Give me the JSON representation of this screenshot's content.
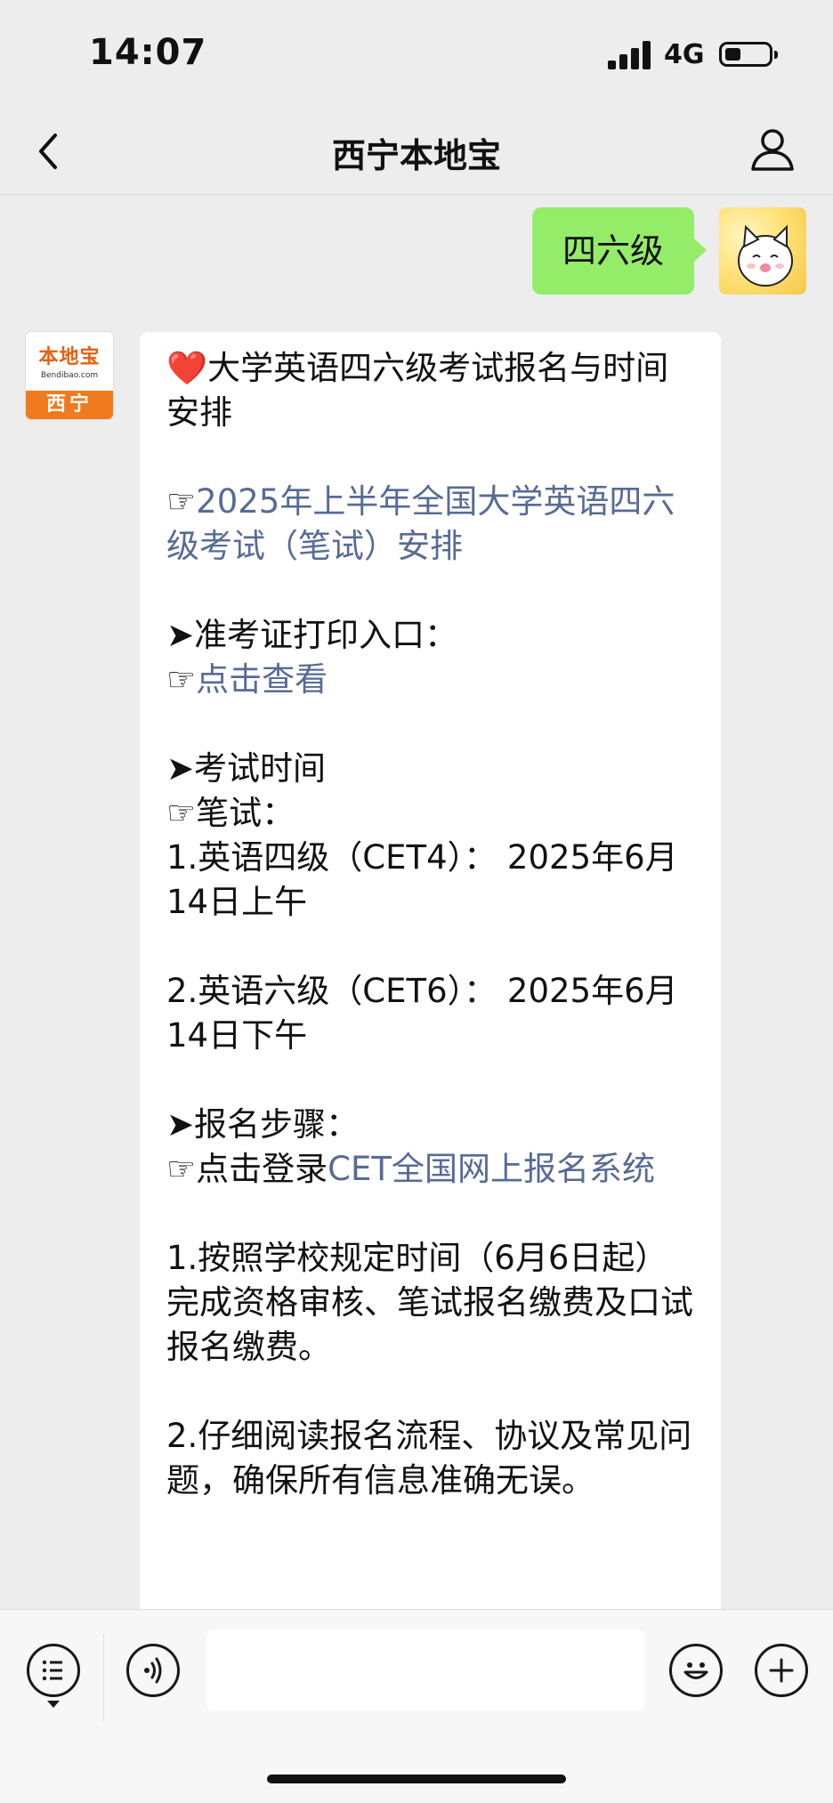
{
  "status": {
    "time": "14:07",
    "network": "4G",
    "battery_level": 0.35
  },
  "nav": {
    "title": "西宁本地宝"
  },
  "user_message": {
    "text": "四六级"
  },
  "sender": {
    "logo_name": "本地宝",
    "logo_url": "Bendibao.com",
    "logo_city": "西宁"
  },
  "message": {
    "heading_icon": "❤️",
    "heading": "大学英语四六级考试报名与时间安排",
    "pointer": "☞",
    "arrow": "➤",
    "link1": "2025年上半年全国大学英语四六级考试（笔试）安排",
    "admit_heading": "准考证打印入口：",
    "admit_link": "点击查看",
    "time_heading": "考试时间",
    "written": "笔试：",
    "cet4": "1.英语四级（CET4）： 2025年6月14日上午",
    "cet6": "2.英语六级（CET6）： 2025年6月14日下午",
    "steps_heading": "报名步骤：",
    "login_prefix": "点击登录",
    "login_link": "CET全国网上报名系统",
    "step1": "1.按照学校规定时间（6月6日起）完成资格审核、笔试报名缴费及口试报名缴费。",
    "step2": "2.仔细阅读报名流程、协议及常见问题，确保所有信息准确无误。"
  },
  "input": {
    "value": "",
    "placeholder": ""
  },
  "icons": {
    "back": "chevron-left-icon",
    "profile": "person-icon",
    "menu": "list-menu-icon",
    "voice": "voice-icon",
    "emoji": "emoji-icon",
    "plus": "plus-icon"
  },
  "colors": {
    "user_bubble": "#95ec69",
    "link": "#576b95",
    "background": "#ededed"
  }
}
